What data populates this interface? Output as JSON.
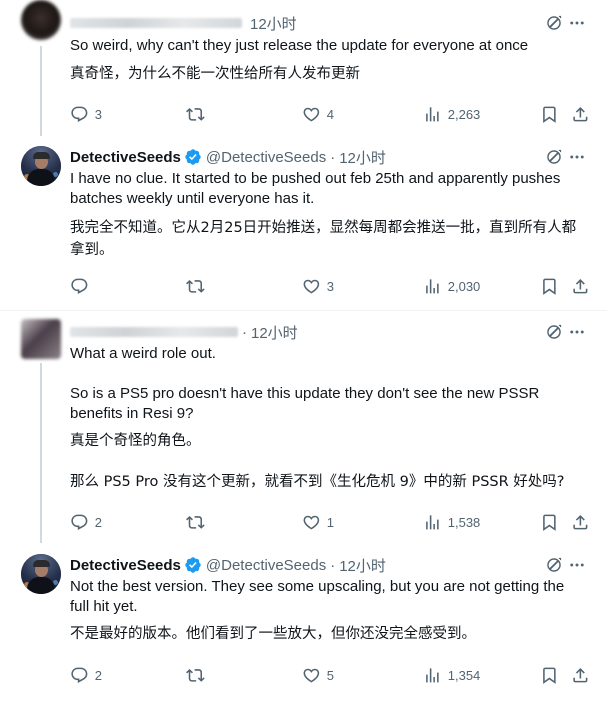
{
  "tweets": [
    {
      "author_name": "",
      "handle": "",
      "time": "12小时",
      "text_en": "So weird, why can't they just release the update for everyone at once",
      "text_zh": "真奇怪，为什么不能一次性给所有人发布更新",
      "replies": "3",
      "retweets": "",
      "likes": "4",
      "views": "2,263"
    },
    {
      "author_name": "DetectiveSeeds",
      "handle": "@DetectiveSeeds",
      "time": "12小时",
      "text_en": "I have no clue. It started to be pushed out feb 25th and apparently pushes batches weekly until everyone has it.",
      "text_zh": "我完全不知道。它从2月25日开始推送，显然每周都会推送一批，直到所有人都拿到。",
      "replies": "",
      "retweets": "",
      "likes": "3",
      "views": "2,030"
    },
    {
      "author_name": "",
      "handle": "",
      "time": "12小时",
      "text_en_1": "What a weird role out.",
      "text_en_2": "So is a PS5 pro doesn't have this update they don't see the new PSSR benefits in Resi 9?",
      "text_zh_1": "真是个奇怪的角色。",
      "text_zh_2": "那么 PS5 Pro 没有这个更新，就看不到《生化危机 9》中的新 PSSR 好处吗?",
      "replies": "2",
      "retweets": "",
      "likes": "1",
      "views": "1,538"
    },
    {
      "author_name": "DetectiveSeeds",
      "handle": "@DetectiveSeeds",
      "time": "12小时",
      "text_en": "Not the best version. They see some upscaling, but you are not getting the full hit yet.",
      "text_zh": "不是最好的版本。他们看到了一些放大，但你还没完全感受到。",
      "replies": "2",
      "retweets": "",
      "likes": "5",
      "views": "1,354"
    }
  ],
  "icons": {
    "reply": "reply-icon",
    "retweet": "retweet-icon",
    "like": "heart-icon",
    "views": "views-icon",
    "bookmark": "bookmark-icon",
    "share": "share-icon",
    "grok": "grok-icon",
    "more": "more-icon",
    "verified": "verified-badge-icon"
  },
  "colors": {
    "text": "#0f1419",
    "secondary": "#536471",
    "verified": "#1d9bf0",
    "divider": "#eff3f4",
    "thread_line": "#cfd9de"
  }
}
